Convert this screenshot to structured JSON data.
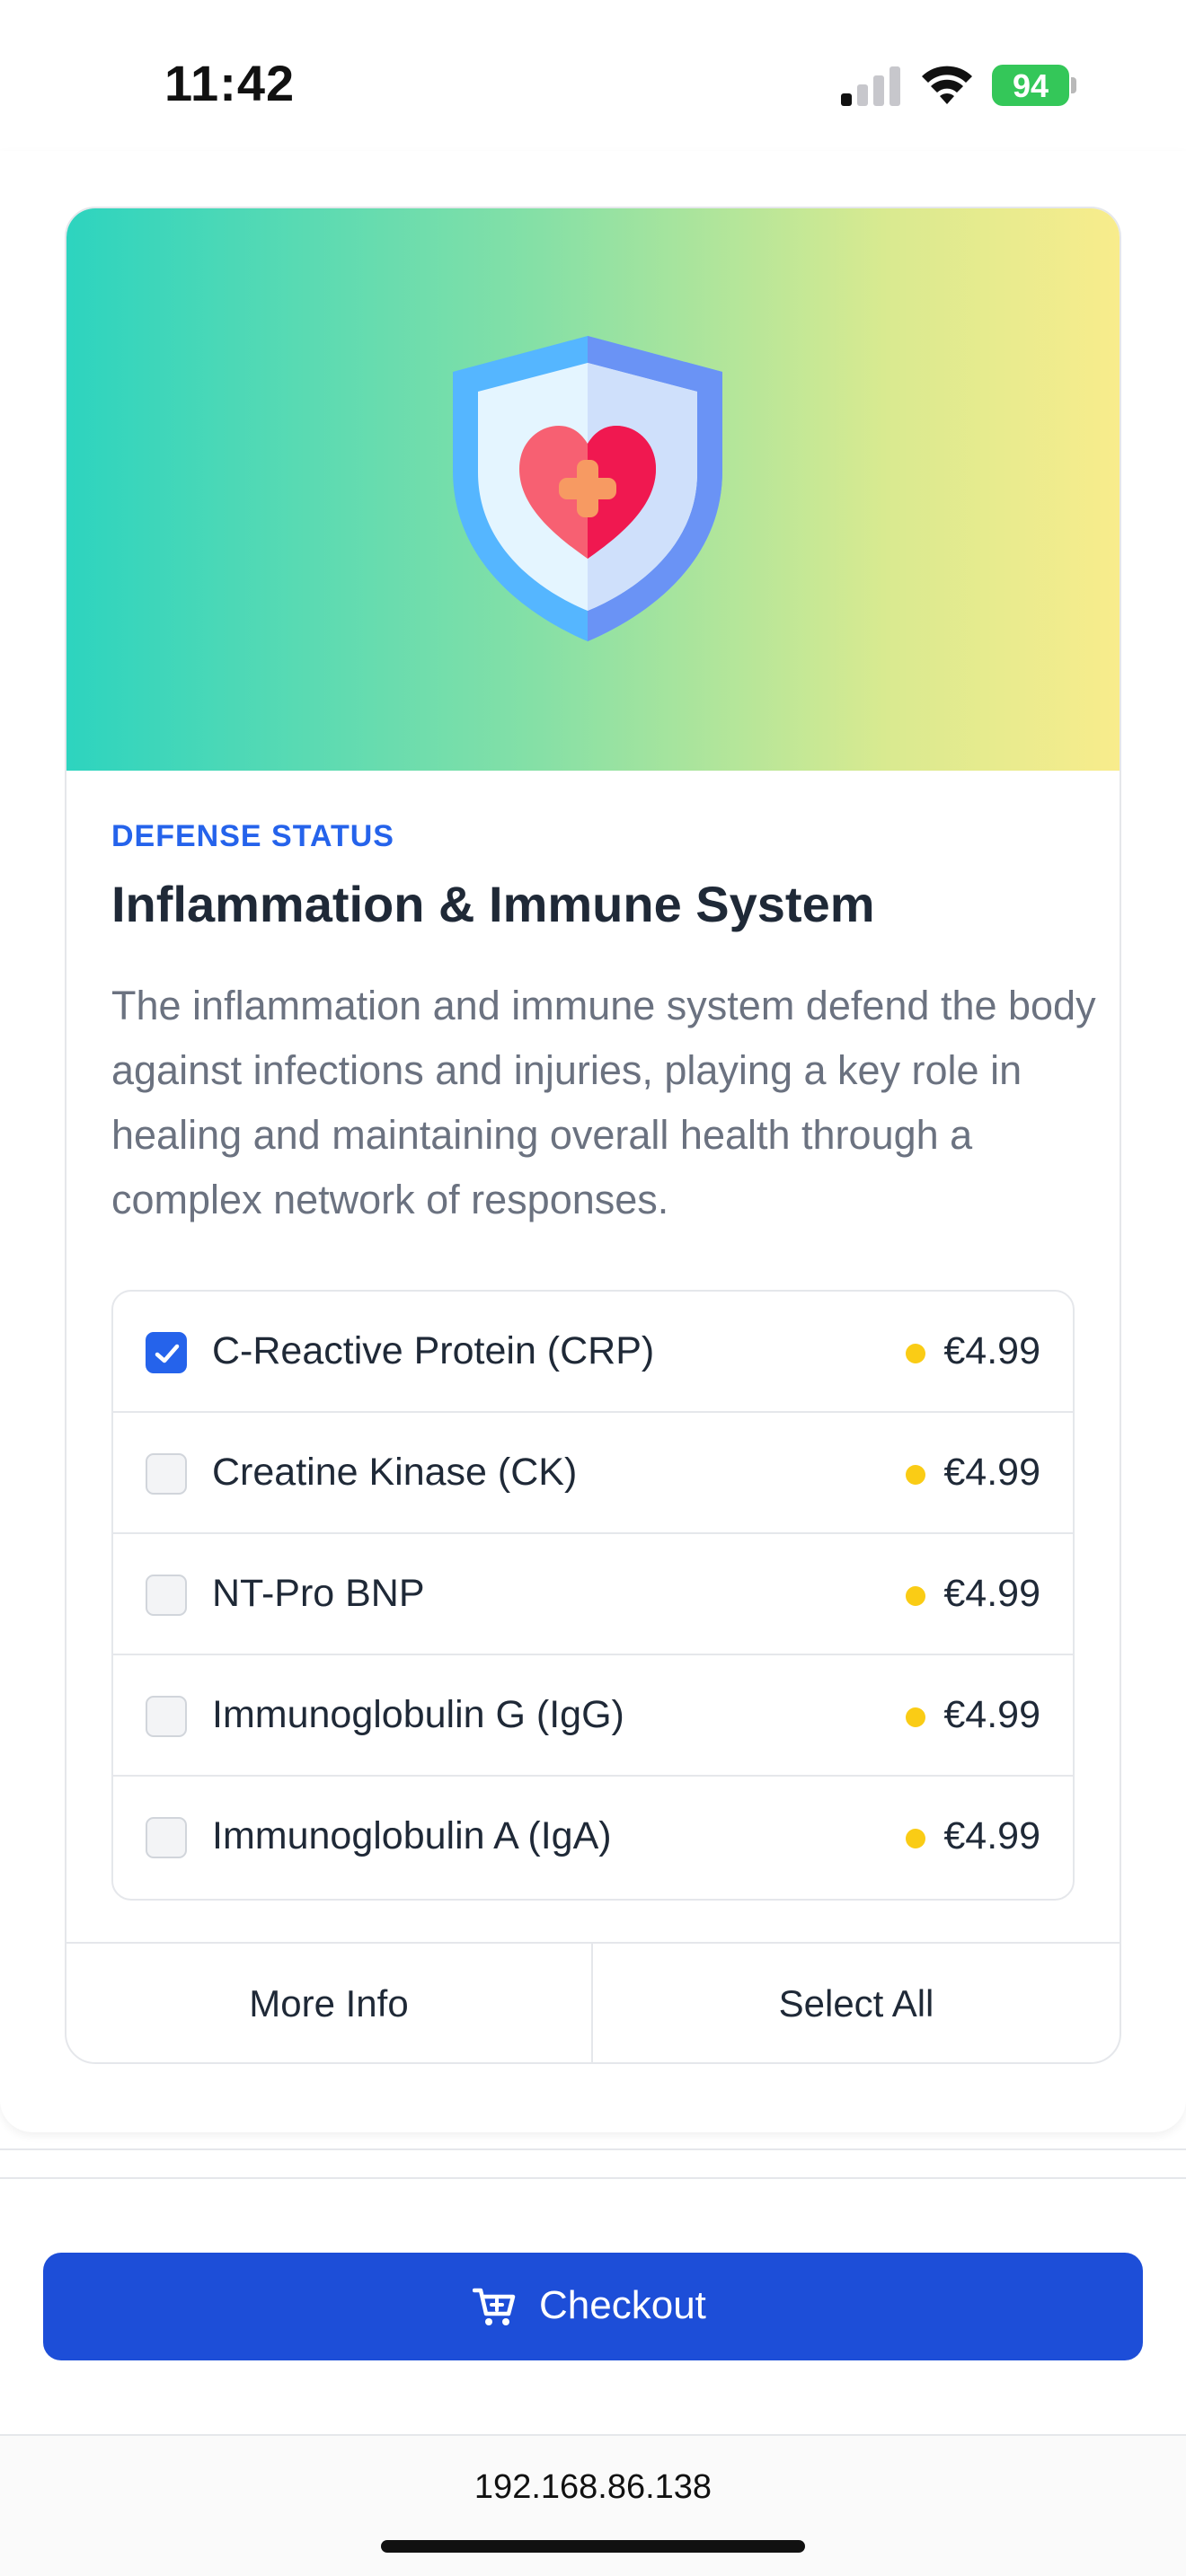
{
  "status_bar": {
    "time": "11:42",
    "battery": "94"
  },
  "card": {
    "category": "DEFENSE STATUS",
    "title": "Inflammation & Immune System",
    "description": "The inflammation and immune system defend the body against infections and injuries, playing a key role in healing and maintaining overall health through a complex network of responses.",
    "hero_icon": "shield-heart-icon",
    "tests": [
      {
        "name": "C-Reactive Protein (CRP)",
        "price": "€4.99",
        "checked": true
      },
      {
        "name": "Creatine Kinase (CK)",
        "price": "€4.99",
        "checked": false
      },
      {
        "name": "NT-Pro BNP",
        "price": "€4.99",
        "checked": false
      },
      {
        "name": "Immunoglobulin G (IgG)",
        "price": "€4.99",
        "checked": false
      },
      {
        "name": "Immunoglobulin A (IgA)",
        "price": "€4.99",
        "checked": false
      }
    ],
    "more_info_label": "More Info",
    "select_all_label": "Select All"
  },
  "checkout": {
    "label": "Checkout",
    "icon": "cart-icon"
  },
  "browser": {
    "url": "192.168.86.138"
  },
  "colors": {
    "accent": "#1d4ed8",
    "category": "#2563eb",
    "price_dot": "#facc15",
    "battery": "#34c759"
  }
}
